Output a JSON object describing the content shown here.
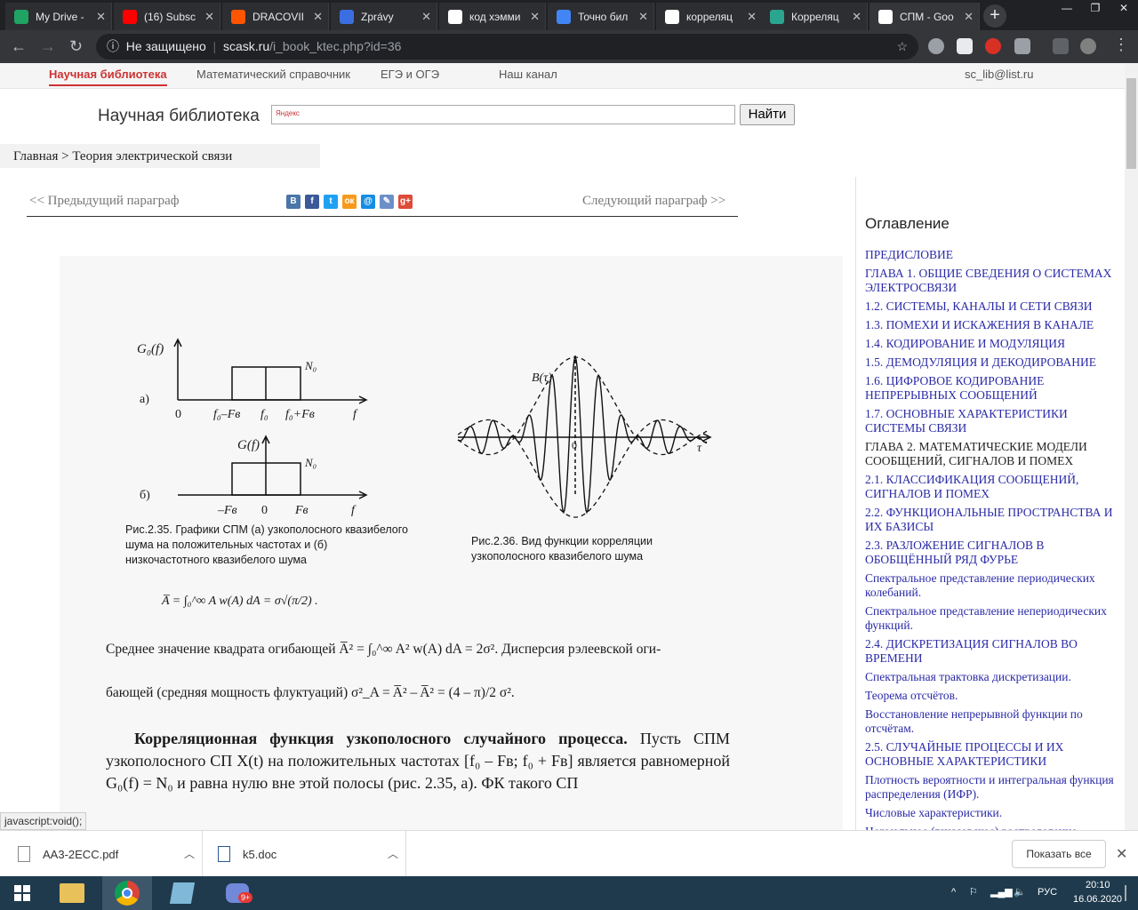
{
  "browser": {
    "tabs": [
      {
        "title": "My Drive -",
        "favicon_color": "#1fa463",
        "icon": "drive-icon"
      },
      {
        "title": "(16) Subsc",
        "favicon_color": "#ff0000",
        "icon": "youtube-icon"
      },
      {
        "title": "DRACOVII",
        "favicon_color": "#ff5500",
        "icon": "soundcloud-icon"
      },
      {
        "title": "Zprávy",
        "favicon_color": "#3b6ee0",
        "icon": "chat-icon"
      },
      {
        "title": "код хэмми",
        "favicon_color": "#ffffff",
        "icon": "google-icon"
      },
      {
        "title": "Точно бил",
        "favicon_color": "#4285f4",
        "icon": "docs-icon"
      },
      {
        "title": "корреляц",
        "favicon_color": "#ffffff",
        "icon": "google-icon"
      },
      {
        "title": "Корреляц",
        "favicon_color": "#2aa58f",
        "icon": "pi-icon"
      },
      {
        "title": "СПМ - Goo",
        "favicon_color": "#ffffff",
        "icon": "google-icon"
      }
    ],
    "url_security": "Не защищено",
    "url_host": "scask.ru",
    "url_path": "/i_book_ktec.php?id=36",
    "status_text": "javascript:void();"
  },
  "site": {
    "topnav": [
      "Научная библиотека",
      "Математический справочник",
      "ЕГЭ и ОГЭ",
      "Наш канал"
    ],
    "email": "sc_lib@list.ru",
    "brand": "Научная библиотека",
    "search_placeholder": "Яндекс",
    "search_button": "Найти",
    "breadcrumb": "Главная > Теория электрической связи",
    "prev": "<< Предыдущий параграф",
    "next": "Следующий параграф >>",
    "share": [
      "В",
      "f",
      "t",
      "ок",
      "@",
      "✎",
      "g+"
    ]
  },
  "scan": {
    "fig235": {
      "ylabel_a": "G₀(f)",
      "label_a": "а)",
      "n0_a": "N₀",
      "ticks_a": [
        "0",
        "f₀–Fв",
        "f₀",
        "f₀+Fв",
        "f"
      ],
      "ylabel_b": "G(f)",
      "label_b": "б)",
      "n0_b": "N₀",
      "ticks_b": [
        "–Fв",
        "0",
        "Fв",
        "f"
      ],
      "caption": "Рис.2.35. Графики СПМ (а) узкополосного квазибелого шума на положительных частотах и (б) низкочастотного квазибелого шума"
    },
    "fig236": {
      "ylabel": "B(τ)",
      "xlabel": "τ",
      "origin": "0",
      "caption": "Рис.2.36. Вид функции корреляции узкополосного квазибелого шума"
    },
    "formula1": "A̅ = ∫₀^∞ A w(A) dA = σ√(π/2) .",
    "line1": "Среднее значение квадрата огибающей A̅² = ∫₀^∞ A² w(A) dA = 2σ². Дисперсия рэлеевской оги-",
    "line2": "бающей (средняя мощность флуктуаций) σ²_A = A̅² – A̅² = (4 – π)/2 σ².",
    "para_bold": "Корреляционная функция узкополосного случайного процесса.",
    "para_rest": " Пусть СПМ узкополосного СП X(t) на положительных частотах [f₀ – Fв; f₀ + Fв] является равномерной G₀(f) = N₀ и равна нулю вне этой полосы (рис. 2.35, а). ФК такого СП"
  },
  "toc": {
    "title": "Оглавление",
    "items": [
      {
        "label": "ПРЕДИСЛОВИЕ",
        "current": false
      },
      {
        "label": "ГЛАВА 1. ОБЩИЕ СВЕДЕНИЯ О СИСТЕМАХ ЭЛЕКТРОСВЯЗИ",
        "current": false
      },
      {
        "label": "1.2. СИСТЕМЫ, КАНАЛЫ И СЕТИ СВЯЗИ",
        "current": false
      },
      {
        "label": "1.3. ПОМЕХИ И ИСКАЖЕНИЯ В КАНАЛЕ",
        "current": false
      },
      {
        "label": "1.4. КОДИРОВАНИЕ И МОДУЛЯЦИЯ",
        "current": false
      },
      {
        "label": "1.5. ДЕМОДУЛЯЦИЯ И ДЕКОДИРОВАНИЕ",
        "current": false
      },
      {
        "label": "1.6. ЦИФРОВОЕ КОДИРОВАНИЕ НЕПРЕРЫВНЫХ СООБЩЕНИЙ",
        "current": false
      },
      {
        "label": "1.7. ОСНОВНЫЕ ХАРАКТЕРИСТИКИ СИСТЕМЫ СВЯЗИ",
        "current": false
      },
      {
        "label": "ГЛАВА 2. МАТЕМАТИЧЕСКИЕ МОДЕЛИ СООБЩЕНИЙ, СИГНАЛОВ И ПОМЕХ",
        "current": true
      },
      {
        "label": "2.1. КЛАССИФИКАЦИЯ СООБЩЕНИЙ, СИГНАЛОВ И ПОМЕХ",
        "current": false
      },
      {
        "label": "2.2. ФУНКЦИОНАЛЬНЫЕ ПРОСТРАНСТВА И ИХ БАЗИСЫ",
        "current": false
      },
      {
        "label": "2.3. РАЗЛОЖЕНИЕ СИГНАЛОВ В ОБОБЩЁННЫЙ РЯД ФУРЬЕ",
        "current": false
      },
      {
        "label": "Спектральное представление периодических колебаний.",
        "current": false
      },
      {
        "label": "Спектральное представление непериодических функций.",
        "current": false
      },
      {
        "label": "2.4. ДИСКРЕТИЗАЦИЯ СИГНАЛОВ ВО ВРЕМЕНИ",
        "current": false
      },
      {
        "label": "Спектральная трактовка дискретизации.",
        "current": false
      },
      {
        "label": "Теорема отсчётов.",
        "current": false
      },
      {
        "label": "Восстановление непрерывной функции по отсчётам.",
        "current": false
      },
      {
        "label": "2.5. СЛУЧАЙНЫЕ ПРОЦЕССЫ И ИХ ОСНОВНЫЕ ХАРАКТЕРИСТИКИ",
        "current": false
      },
      {
        "label": "Плотность вероятности и интегральная функция распределения (ИФР).",
        "current": false
      },
      {
        "label": "Числовые характеристики.",
        "current": false
      },
      {
        "label": "Нормальное (гауссовское) распределение",
        "current": false
      }
    ]
  },
  "downloads": {
    "items": [
      "AA3-2ECC.pdf",
      "k5.doc"
    ],
    "show_all": "Показать все"
  },
  "taskbar": {
    "lang": "РУС",
    "time": "20:10",
    "date": "16.06.2020",
    "discord_badge": "9+"
  }
}
